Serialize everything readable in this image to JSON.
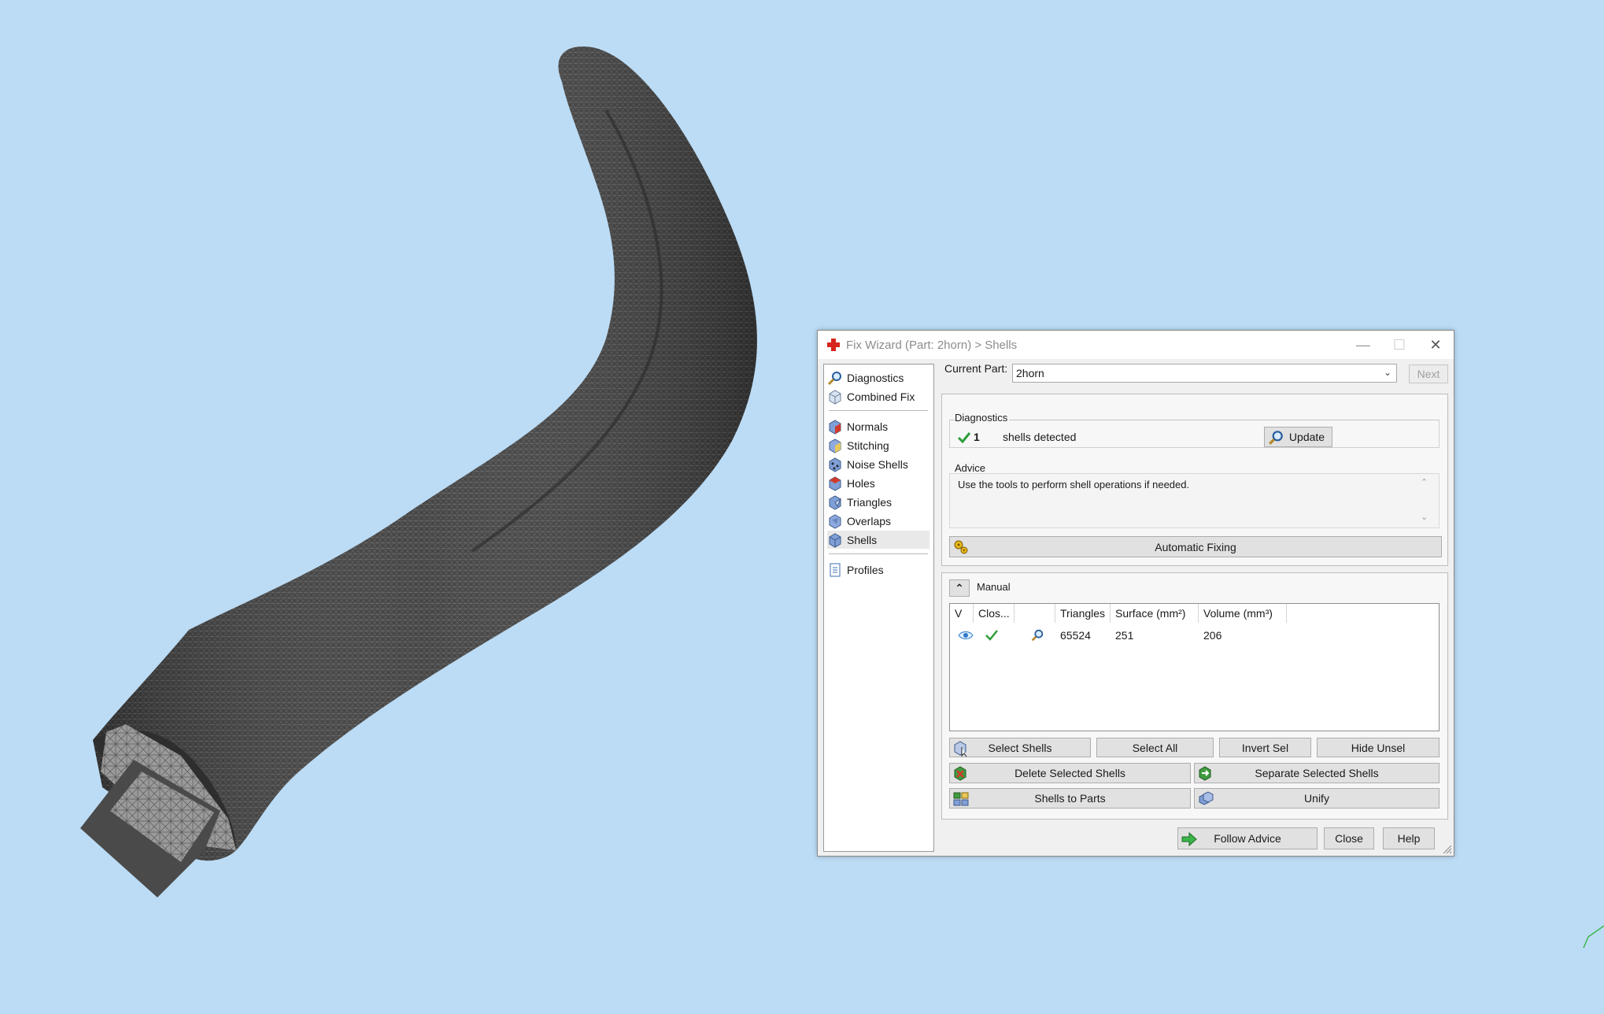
{
  "window": {
    "title": "Fix Wizard (Part: 2horn) > Shells",
    "minimize_glyph": "—",
    "maximize_glyph": "☐",
    "close_glyph": "✕"
  },
  "sidebar": {
    "items": [
      {
        "label": "Diagnostics",
        "icon": "magnifier-icon"
      },
      {
        "label": "Combined Fix",
        "icon": "cube-icon"
      },
      {
        "label": "Normals",
        "icon": "normals-cube-icon"
      },
      {
        "label": "Stitching",
        "icon": "stitching-cube-icon"
      },
      {
        "label": "Noise Shells",
        "icon": "noise-cube-icon"
      },
      {
        "label": "Holes",
        "icon": "holes-cube-icon"
      },
      {
        "label": "Triangles",
        "icon": "triangles-cube-icon"
      },
      {
        "label": "Overlaps",
        "icon": "overlaps-cube-icon"
      },
      {
        "label": "Shells",
        "icon": "shells-cube-icon"
      },
      {
        "label": "Profiles",
        "icon": "document-icon"
      }
    ],
    "active": "Shells"
  },
  "current_part": {
    "label": "Current Part:",
    "value": "2horn",
    "next_label": "Next"
  },
  "diagnostics": {
    "label": "Diagnostics",
    "count": "1",
    "text": "shells detected",
    "update_label": "Update"
  },
  "advice": {
    "label": "Advice",
    "text": "Use the tools to perform shell operations if needed.",
    "auto_fix_label": "Automatic Fixing"
  },
  "manual": {
    "label": "Manual",
    "collapse_glyph": "⌃",
    "columns": [
      "V",
      "Clos...",
      "",
      "Triangles",
      "Surface (mm²)",
      "Volume (mm³)"
    ],
    "rows": [
      {
        "triangles": "65524",
        "surface": "251",
        "volume": "206"
      }
    ],
    "buttons": {
      "select_shells": "Select Shells",
      "select_all": "Select All",
      "invert_sel": "Invert Sel",
      "hide_unsel": "Hide Unsel",
      "delete_selected": "Delete Selected Shells",
      "separate_selected": "Separate Selected Shells",
      "shells_to_parts": "Shells to Parts",
      "unify": "Unify"
    }
  },
  "footer": {
    "follow_advice": "Follow Advice",
    "close": "Close",
    "help": "Help"
  },
  "colors": {
    "background": "#bcdcf5",
    "mesh": "#3a3a3a",
    "check": "#2e9e3a",
    "title_icon": "#d7261e"
  }
}
